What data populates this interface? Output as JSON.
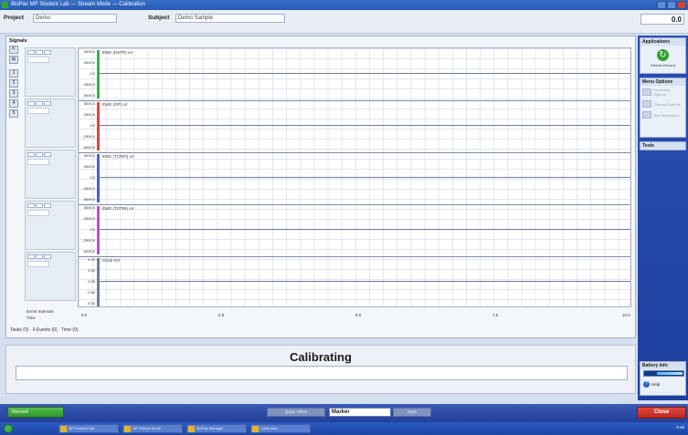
{
  "window": {
    "title": "BioPac MP Student Lab — Stream Mode — Calibration"
  },
  "topbar": {
    "project_label": "Project",
    "project_value": "Demo",
    "subject_label": "Subject",
    "subject_value": "Demo Sample",
    "speed_value": "0.0"
  },
  "signals": {
    "header": "Signals",
    "channels": [
      {
        "label": "EMG (DSTR) uV",
        "color": "#38b24a",
        "ticks": [
          "5000.0",
          "2500.0",
          "0.0",
          "-2500.0",
          "-5000.0"
        ]
      },
      {
        "label": "EMG (GP) uV",
        "color": "#e2453a",
        "ticks": [
          "5000.0",
          "2500.0",
          "0.0",
          "-2500.0",
          "-5000.0"
        ]
      },
      {
        "label": "EMG (TCRRI) uV",
        "color": "#4463d6",
        "ticks": [
          "5000.0",
          "2500.0",
          "0.0",
          "-2500.0",
          "-5000.0"
        ]
      },
      {
        "label": "EMG (TOTRI) uV",
        "color": "#b84fd2",
        "ticks": [
          "5000.0",
          "2500.0",
          "0.0",
          "-2500.0",
          "-5000.0"
        ]
      },
      {
        "label": "Clock mV",
        "color": "#6d7d98",
        "ticks": [
          "5.00",
          "2.50",
          "0.00",
          "-2.50",
          "-5.00"
        ]
      }
    ],
    "time_ticks": [
      "0.0",
      "2.5",
      "5.0",
      "7.5",
      "10.0"
    ],
    "axis_labels": {
      "event": "Event Intervals",
      "time": "Time"
    },
    "status_line": "Tasks (0) · 0 Events (0) · Time (0)"
  },
  "calibration": {
    "title": "Calibrating"
  },
  "right_panel": {
    "applications_title": "Applications",
    "record_label": "Stream Record",
    "menu_title": "Menu Options",
    "menu_items": [
      "Recording Options",
      "Channel Options",
      "Run Diagnostics"
    ],
    "tools_title": "Tools",
    "battery_title": "Battery Info",
    "help_label": "Help"
  },
  "bottom": {
    "record_button": "Record",
    "mark_prev": "Quick Offset",
    "marker_value": "Marker",
    "mark_next": "Mark",
    "close_button": "Close"
  },
  "taskbar": {
    "items": [
      "MP Student Lab",
      "MP Stream Mode",
      "BioPac Manager",
      "Calibration"
    ],
    "clock": "8:45"
  }
}
